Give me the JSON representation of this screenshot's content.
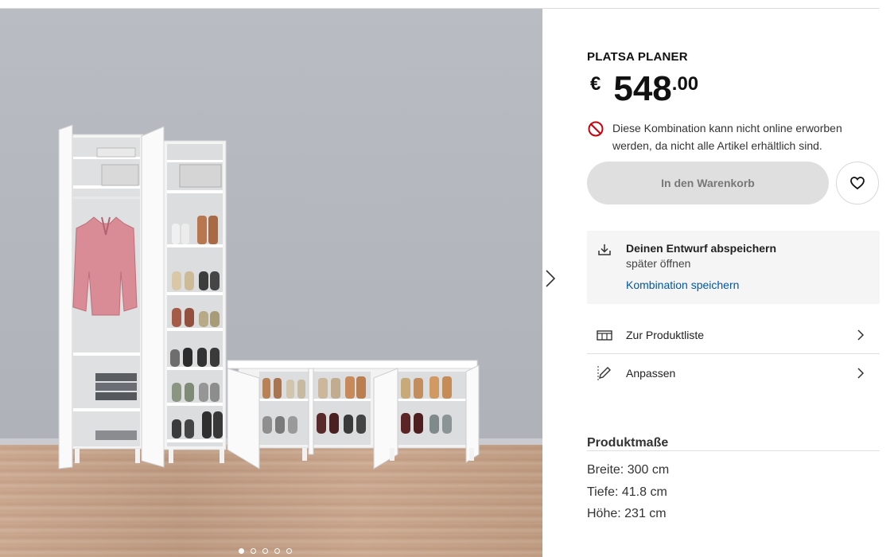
{
  "product": {
    "title": "PLATSA PLANER",
    "currency": "€",
    "price_int": "548",
    "price_dec": ".00"
  },
  "availability": {
    "message": "Diese Kombination kann nicht online erworben werden, da nicht alle Artikel erhältlich sind.",
    "icon": "not-allowed-icon",
    "icon_color": "#cc0008"
  },
  "actions": {
    "add_to_cart_label": "In den Warenkorb",
    "favorite_icon": "heart-icon"
  },
  "save_design": {
    "heading": "Deinen Entwurf abspeichern",
    "subtext": "später öffnen",
    "link": "Kombination speichern",
    "link_color": "#0058a3"
  },
  "links": [
    {
      "label": "Zur Produktliste",
      "icon": "product-list-icon"
    },
    {
      "label": "Anpassen",
      "icon": "pencil-icon"
    }
  ],
  "dimensions": {
    "heading": "Produktmaße",
    "items": [
      "Breite: 300 cm",
      "Tiefe: 41.8 cm",
      "Höhe: 231 cm"
    ]
  },
  "gallery": {
    "slide_count": 5,
    "active_slide": 1,
    "next_icon": "chevron-right-icon"
  }
}
